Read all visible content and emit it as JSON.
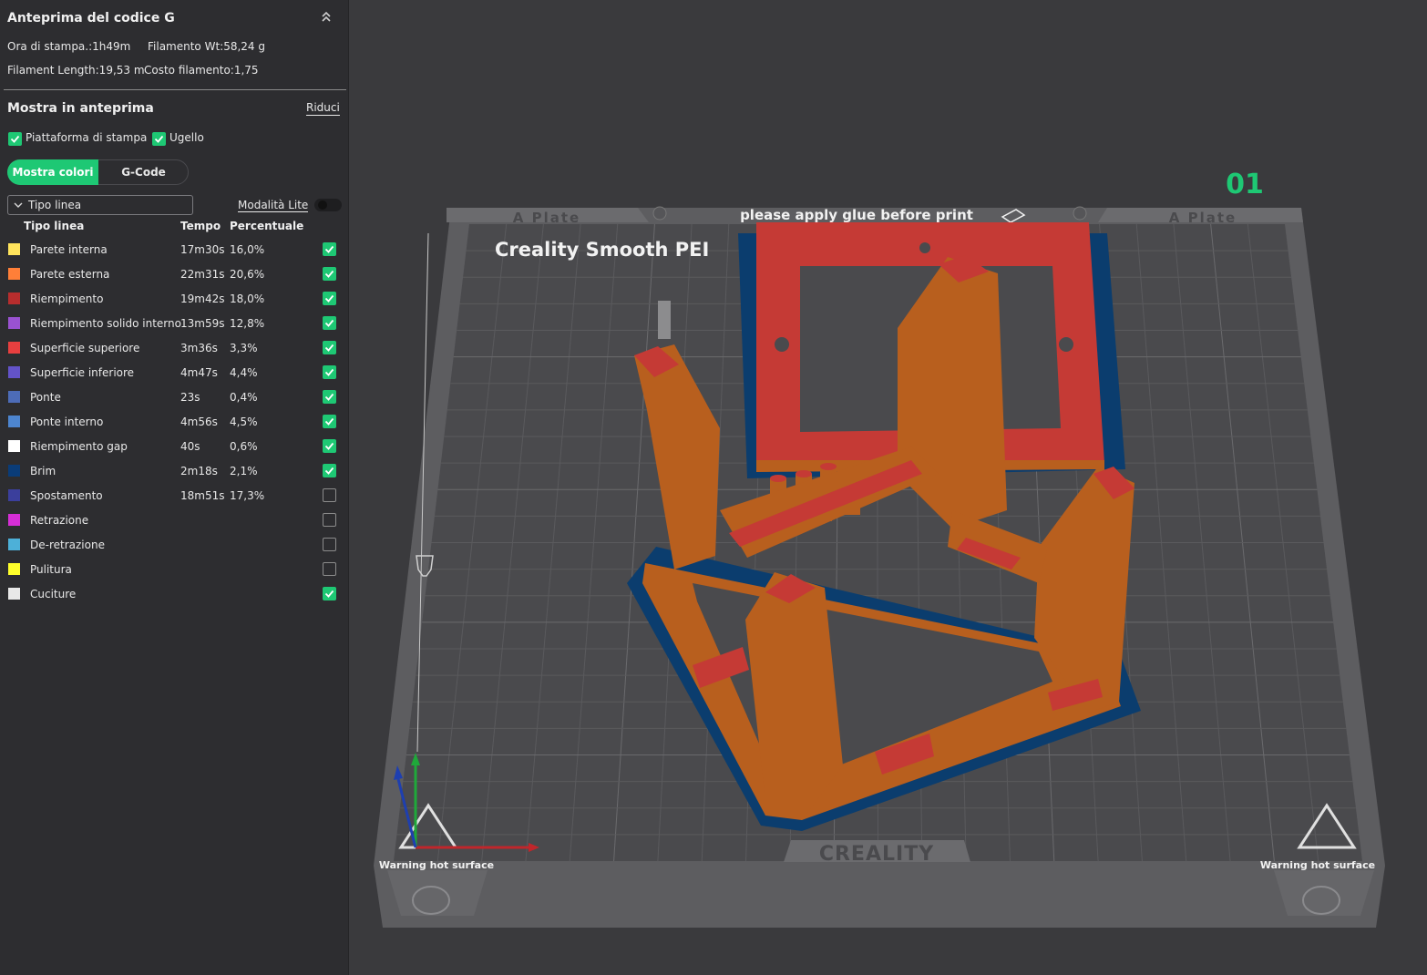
{
  "panel": {
    "title": "Anteprima del codice G",
    "stats": {
      "print_time": "Ora di stampa.:1h49m",
      "filament_weight": "Filamento Wt:58,24 g",
      "filament_length": "Filament Length:19,53 m",
      "filament_cost": "Costo filamento:1,75"
    },
    "preview_section": {
      "title": "Mostra in anteprima",
      "reduce_link": "Riduci",
      "checkboxes": [
        {
          "label": "Piattaforma di stampa",
          "checked": true
        },
        {
          "label": "Ugello",
          "checked": true
        }
      ]
    },
    "tabs": [
      {
        "label": "Mostra colori",
        "active": true
      },
      {
        "label": "G-Code",
        "active": false
      }
    ],
    "view_select": {
      "value": "Tipo linea"
    },
    "lite_mode": {
      "label": "Modalità Lite",
      "on": false
    },
    "table": {
      "headers": [
        "Tipo linea",
        "Tempo",
        "Percentuale"
      ],
      "rows": [
        {
          "name": "Parete interna",
          "time": "17m30s",
          "pct": "16,0%",
          "color": "#ffe45c",
          "checked": true
        },
        {
          "name": "Parete esterna",
          "time": "22m31s",
          "pct": "20,6%",
          "color": "#ff7f38",
          "checked": true
        },
        {
          "name": "Riempimento",
          "time": "19m42s",
          "pct": "18,0%",
          "color": "#b72d2d",
          "checked": true
        },
        {
          "name": "Riempimento solido interno",
          "time": "13m59s",
          "pct": "12,8%",
          "color": "#9a52d1",
          "checked": true
        },
        {
          "name": "Superficie superiore",
          "time": "3m36s",
          "pct": "3,3%",
          "color": "#e83f3f",
          "checked": true
        },
        {
          "name": "Superficie inferiore",
          "time": "4m47s",
          "pct": "4,4%",
          "color": "#6353c9",
          "checked": true
        },
        {
          "name": "Ponte",
          "time": "23s",
          "pct": "0,4%",
          "color": "#4d6cb7",
          "checked": true
        },
        {
          "name": "Ponte interno",
          "time": "4m56s",
          "pct": "4,5%",
          "color": "#4d85cf",
          "checked": true
        },
        {
          "name": "Riempimento gap",
          "time": "40s",
          "pct": "0,6%",
          "color": "#ffffff",
          "checked": true
        },
        {
          "name": "Brim",
          "time": "2m18s",
          "pct": "2,1%",
          "color": "#0a3c78",
          "checked": true
        },
        {
          "name": "Spostamento",
          "time": "18m51s",
          "pct": "17,3%",
          "color": "#3b3f9c",
          "checked": false
        },
        {
          "name": "Retrazione",
          "time": "",
          "pct": "",
          "color": "#d62ed6",
          "checked": false
        },
        {
          "name": "De-retrazione",
          "time": "",
          "pct": "",
          "color": "#4db0d8",
          "checked": false
        },
        {
          "name": "Pulitura",
          "time": "",
          "pct": "",
          "color": "#ffff2b",
          "checked": false
        },
        {
          "name": "Cuciture",
          "time": "",
          "pct": "",
          "color": "#e8e8e8",
          "checked": true
        }
      ]
    }
  },
  "viewport": {
    "plate_number": "01",
    "plate_label_left": "A Plate",
    "plate_label_right": "A Plate",
    "glue_text": "please apply glue before print",
    "bed_name": "Creality Smooth PEI",
    "brand": "CREALITY",
    "warning_left": "Warning hot surface",
    "warning_right": "Warning hot surface"
  },
  "colors": {
    "accent": "#1ec874",
    "panel_bg": "#2d2d30",
    "viewport_bg": "#3a3a3d",
    "model_wall": "#b85f1e",
    "model_top": "#c53a35",
    "brim": "#0b3d6e"
  }
}
